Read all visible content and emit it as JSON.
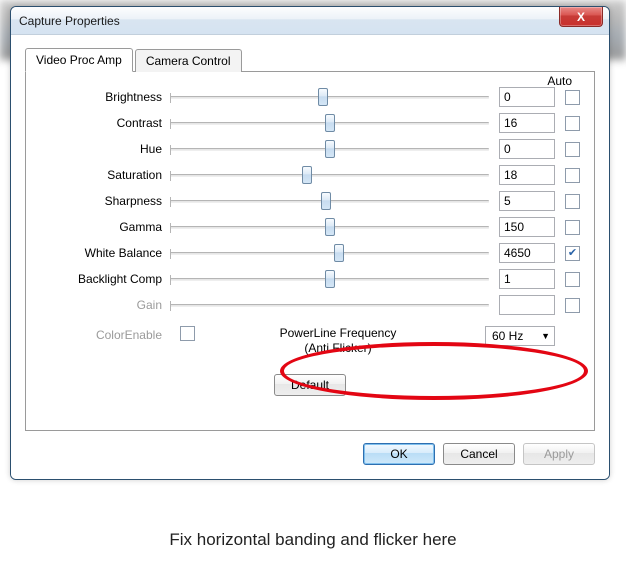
{
  "window": {
    "title": "Capture Properties",
    "close_glyph": "X"
  },
  "tabs": [
    {
      "label": "Video Proc Amp",
      "active": true
    },
    {
      "label": "Camera Control",
      "active": false
    }
  ],
  "auto_header": "Auto",
  "sliders": [
    {
      "label": "Brightness",
      "value": "0",
      "pos": 48,
      "auto": false,
      "disabled": false
    },
    {
      "label": "Contrast",
      "value": "16",
      "pos": 50,
      "auto": false,
      "disabled": false
    },
    {
      "label": "Hue",
      "value": "0",
      "pos": 50,
      "auto": false,
      "disabled": false
    },
    {
      "label": "Saturation",
      "value": "18",
      "pos": 43,
      "auto": false,
      "disabled": false
    },
    {
      "label": "Sharpness",
      "value": "5",
      "pos": 49,
      "auto": false,
      "disabled": false
    },
    {
      "label": "Gamma",
      "value": "150",
      "pos": 50,
      "auto": false,
      "disabled": false
    },
    {
      "label": "White Balance",
      "value": "4650",
      "pos": 53,
      "auto": true,
      "disabled": false
    },
    {
      "label": "Backlight Comp",
      "value": "1",
      "pos": 50,
      "auto": false,
      "disabled": false
    },
    {
      "label": "Gain",
      "value": "",
      "pos": 0,
      "auto": false,
      "disabled": true
    }
  ],
  "color_enable_label": "ColorEnable",
  "powerline": {
    "label1": "PowerLine Frequency",
    "label2": "(Anti Flicker)",
    "value": "60 Hz"
  },
  "buttons": {
    "default": "Default",
    "ok": "OK",
    "cancel": "Cancel",
    "apply": "Apply"
  },
  "caption": "Fix horizontal banding and flicker here"
}
